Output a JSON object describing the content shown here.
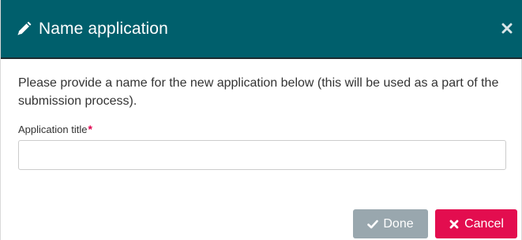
{
  "dialog": {
    "title": "Name application",
    "description": "Please provide a name for the new application below (this will be used as a part of the submission process).",
    "field": {
      "label": "Application title",
      "required_marker": "*",
      "value": "",
      "placeholder": ""
    },
    "buttons": {
      "done_label": "Done",
      "cancel_label": "Cancel"
    }
  },
  "colors": {
    "header_bg": "#005f6c",
    "done_bg": "#99a7ae",
    "cancel_bg": "#e30d4f",
    "required": "#e0004d"
  },
  "icons": {
    "title": "pencil-icon",
    "close": "close-icon",
    "done": "check-icon",
    "cancel": "x-icon"
  }
}
